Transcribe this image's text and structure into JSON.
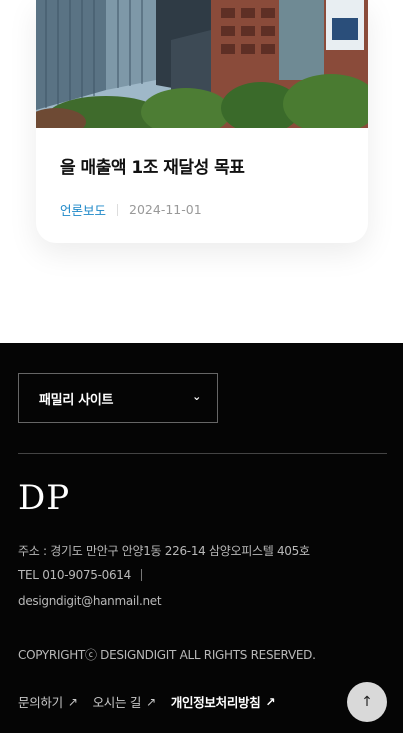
{
  "card": {
    "title": "을 매출액 1조 재달성 목표",
    "category": "언론보도",
    "date": "2024-11-01",
    "image_icon": "building-photo"
  },
  "footer": {
    "family_site_label": "패밀리 사이트",
    "family_site_icon": "chevron-down-icon",
    "logo_text": "DP",
    "address": "주소 : 경기도 만안구 안양1동 226-14 삼양오피스텔 405호",
    "tel": "TEL 010-9075-0614",
    "email": "designdigit@hanmail.net",
    "copyright": "COPYRIGHTⓒ DESIGNDIGIT ALL RIGHTS RESERVED.",
    "links": [
      {
        "label": "문의하기"
      },
      {
        "label": "오시는 길"
      },
      {
        "label": "개인정보처리방침"
      }
    ],
    "link_arrow": "↗",
    "to_top_icon": "arrow-up-icon"
  },
  "colors": {
    "category": "#1e88c8",
    "footer_bg": "#050505",
    "to_top_bg": "#d9d9d9"
  }
}
